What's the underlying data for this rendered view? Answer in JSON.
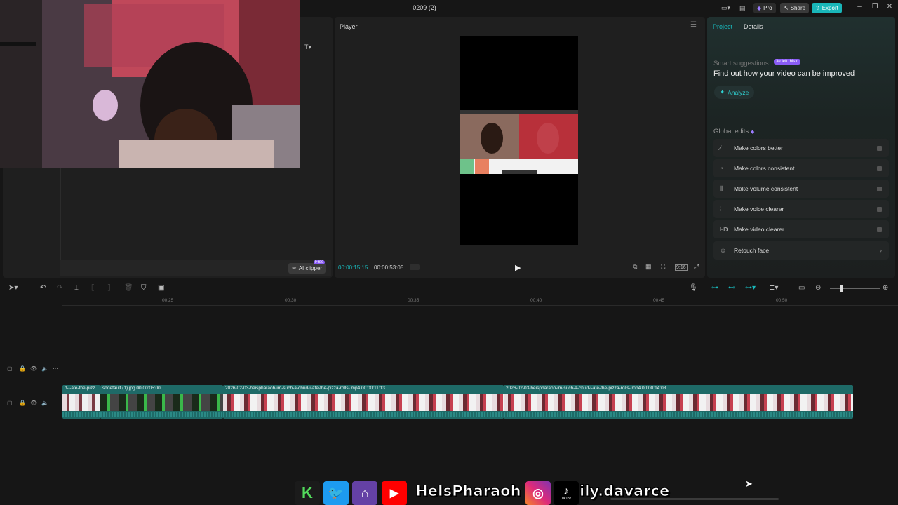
{
  "window": {
    "title": "0209 (2)"
  },
  "titlebar": {
    "pro_label": "Pro",
    "share_label": "Share",
    "export_label": "Export"
  },
  "media": {
    "ai_clipper_label": "AI clipper",
    "free_badge": "Free"
  },
  "player": {
    "title": "Player",
    "timecode_current": "00:00:15:15",
    "timecode_total": "00:00:53:05",
    "aspect_ratio": "9:16"
  },
  "right_panel": {
    "tabs": {
      "project": "Project",
      "details": "Details"
    },
    "smart_suggestions_label": "Smart suggestions",
    "smart_badge": "3e left this n",
    "headline": "Find out how your video can be improved",
    "analyze_label": "Analyze",
    "global_edits_label": "Global edits",
    "items": [
      {
        "label": "Make colors better",
        "icon": "magic-wand-icon"
      },
      {
        "label": "Make colors consistent",
        "icon": "palette-icon"
      },
      {
        "label": "Make volume consistent",
        "icon": "volume-bars-icon"
      },
      {
        "label": "Make voice clearer",
        "icon": "voice-wave-icon"
      },
      {
        "label": "Make video clearer",
        "icon": "hd-icon",
        "icon_text": "HD"
      },
      {
        "label": "Retouch face",
        "icon": "face-icon"
      }
    ]
  },
  "ruler": {
    "ticks": [
      "00:25",
      "00:30",
      "00:35",
      "00:40",
      "00:45",
      "00:50"
    ]
  },
  "clips": [
    {
      "label": "d-i-ate-the-pizz"
    },
    {
      "label": "sddefault (1).jpg  00:00:05:00"
    },
    {
      "label": "2026-02-03-heispharaoh-im-such-a-chud-i-ate-the-pizza-rolls-.mp4  00:00:11:13"
    },
    {
      "label": "2026-02-03-heispharaoh-im-such-a-chud-i-ate-the-pizza-rolls-.mp4  00:00:14:08"
    }
  ],
  "social": {
    "handle_1": "HeIsPharaoh",
    "handle_2": "ily.davarce",
    "tiktok_caption": "TikTok"
  },
  "colors": {
    "accent": "#19b6b9",
    "purple": "#8a5cf6",
    "clip": "#1e6a67"
  }
}
